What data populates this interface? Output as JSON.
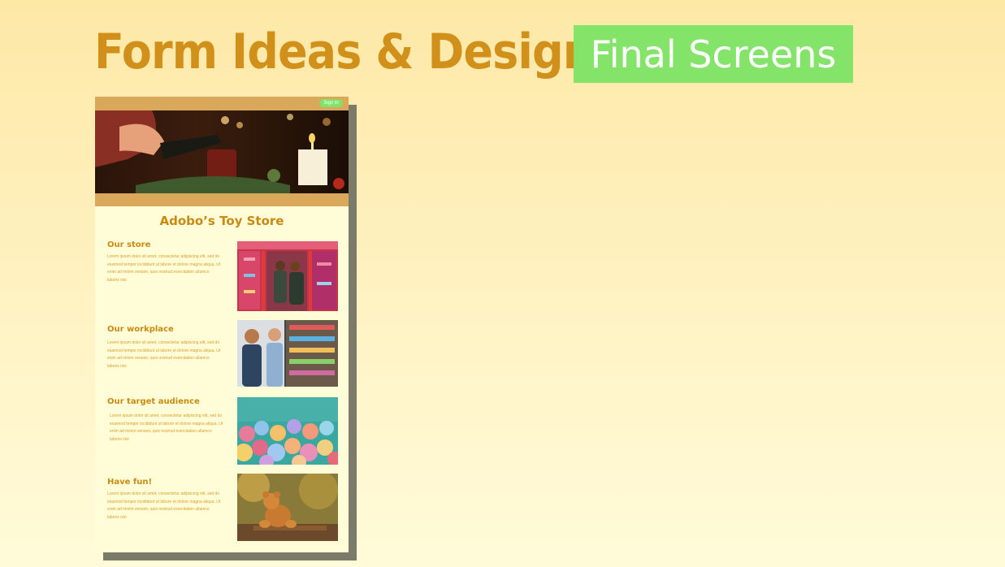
{
  "header": {
    "title": "Form Ideas & Design",
    "badge": "Final Screens"
  },
  "mockup": {
    "signin_label": "Sign in",
    "store_title": "Adobo’s Toy Store",
    "sections": [
      {
        "title": "Our store",
        "body": "Lorem ipsum dolor sit amet, consectetur adipiscing elit, sed do eiusmod tempor incididunt ut labore et dolore magna aliqua. Ut enim ad minim veniam, quis nostrud exercitation ullamco laboris nisi"
      },
      {
        "title": "Our workplace",
        "body": "Lorem ipsum dolor sit amet, consectetur adipiscing elit, sed do eiusmod tempor incididunt ut labore et dolore magna aliqua. Ut enim ad minim veniam, quis nostrud exercitation ullamco laboris nisi"
      },
      {
        "title": "Our target audience",
        "body": "Lorem ipsum dolor sit amet, consectetur adipiscing elit, sed do eiusmod tempor incididunt ut labore et dolore magna aliqua. Ut enim ad minim veniam, quis nostrud exercitation ullamco laboris nisi"
      },
      {
        "title": "Have fun!",
        "body": "Lorem ipsum dolor sit amet, consectetur adipiscing elit, sed do eiusmod tempor incididunt ut labore et dolore magna aliqua. Ut enim ad minim veniam, quis nostrud exercitation ullamco laboris nisi"
      }
    ]
  },
  "colors": {
    "accent": "#d1901a",
    "badge": "#84e46a",
    "mock_bar": "#d9a85b",
    "mock_bg": "#fffcd8"
  }
}
